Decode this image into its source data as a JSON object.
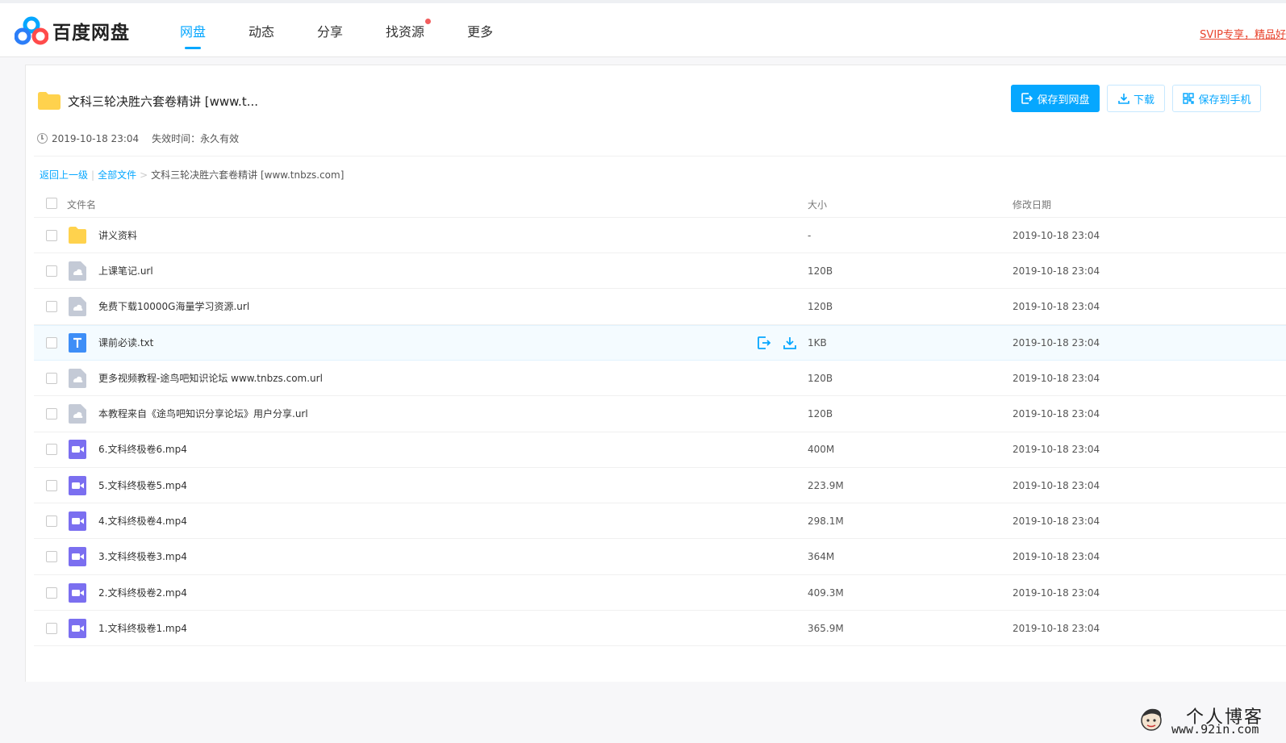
{
  "header": {
    "logo_text": "百度网盘",
    "nav": [
      {
        "label": "网盘",
        "active": true
      },
      {
        "label": "动态",
        "active": false
      },
      {
        "label": "分享",
        "active": false
      },
      {
        "label": "找资源",
        "active": false,
        "dot": true
      },
      {
        "label": "更多",
        "active": false
      }
    ],
    "svip_text": "SVIP专享，精品好"
  },
  "share": {
    "title": "文科三轮决胜六套卷精讲 [www.t...",
    "created": "2019-10-18 23:04",
    "expire": "失效时间：永久有效",
    "buttons": {
      "save": "保存到网盘",
      "download": "下载",
      "save_phone": "保存到手机"
    }
  },
  "breadcrumb": {
    "back": "返回上一级",
    "all": "全部文件",
    "sep": ">",
    "current": "文科三轮决胜六套卷精讲 [www.tnbzs.com]"
  },
  "table": {
    "headers": {
      "name": "文件名",
      "size": "大小",
      "date": "修改日期"
    },
    "rows": [
      {
        "type": "folder",
        "name": "讲义资料",
        "size": "-",
        "date": "2019-10-18 23:04"
      },
      {
        "type": "url",
        "name": "上课笔记.url",
        "size": "120B",
        "date": "2019-10-18 23:04"
      },
      {
        "type": "url",
        "name": "免费下载10000G海量学习资源.url",
        "size": "120B",
        "date": "2019-10-18 23:04"
      },
      {
        "type": "txt",
        "name": "课前必读.txt",
        "size": "1KB",
        "date": "2019-10-18 23:04",
        "hover": true
      },
      {
        "type": "url",
        "name": "更多视频教程-途鸟吧知识论坛 www.tnbzs.com.url",
        "size": "120B",
        "date": "2019-10-18 23:04"
      },
      {
        "type": "url",
        "name": "本教程来自《途鸟吧知识分享论坛》用户分享.url",
        "size": "120B",
        "date": "2019-10-18 23:04"
      },
      {
        "type": "video",
        "name": "6.文科终极卷6.mp4",
        "size": "400M",
        "date": "2019-10-18 23:04"
      },
      {
        "type": "video",
        "name": "5.文科终极卷5.mp4",
        "size": "223.9M",
        "date": "2019-10-18 23:04"
      },
      {
        "type": "video",
        "name": "4.文科终极卷4.mp4",
        "size": "298.1M",
        "date": "2019-10-18 23:04"
      },
      {
        "type": "video",
        "name": "3.文科终极卷3.mp4",
        "size": "364M",
        "date": "2019-10-18 23:04"
      },
      {
        "type": "video",
        "name": "2.文科终极卷2.mp4",
        "size": "409.3M",
        "date": "2019-10-18 23:04"
      },
      {
        "type": "video",
        "name": "1.文科终极卷1.mp4",
        "size": "365.9M",
        "date": "2019-10-18 23:04"
      }
    ]
  },
  "watermark": {
    "title": "个人博客",
    "url": "www.92in.com"
  },
  "colors": {
    "accent": "#06a7ff",
    "folder": "#ffd24d",
    "video": "#7b6ff0",
    "txt": "#3e8ef7",
    "url": "#c4cad6"
  }
}
